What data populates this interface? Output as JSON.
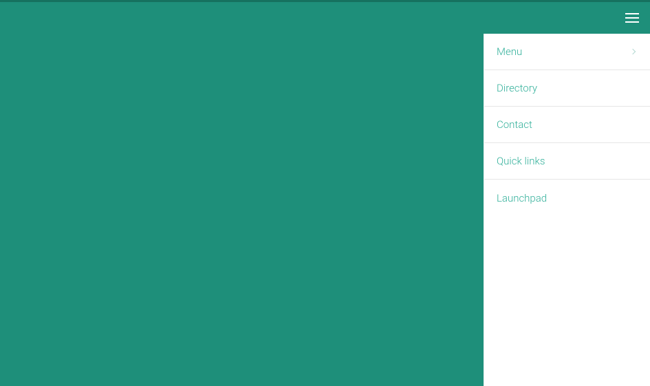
{
  "menu": {
    "items": [
      {
        "label": "Menu",
        "hasChevron": true
      },
      {
        "label": "Directory",
        "hasChevron": false
      },
      {
        "label": "Contact",
        "hasChevron": false
      },
      {
        "label": "Quick links",
        "hasChevron": false
      },
      {
        "label": "Launchpad",
        "hasChevron": false
      }
    ]
  }
}
